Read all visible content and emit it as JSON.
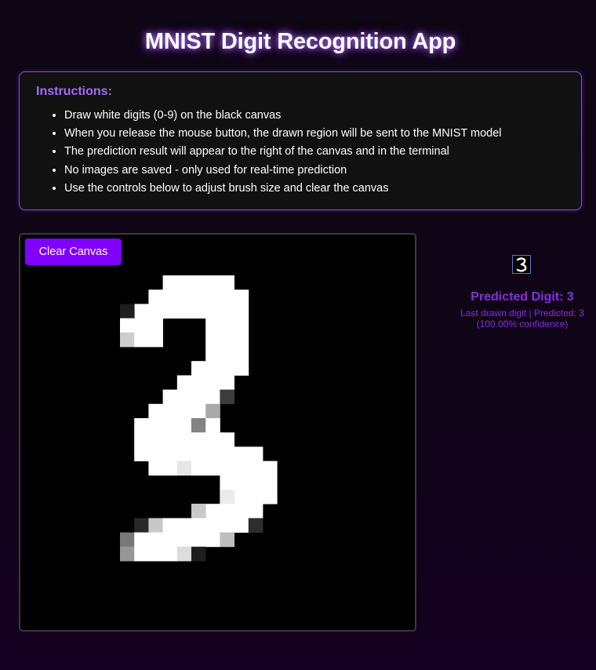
{
  "header": {
    "title": "MNIST Digit Recognition App"
  },
  "instructions": {
    "heading": "Instructions:",
    "items": [
      "Draw white digits (0-9) on the black canvas",
      "When you release the mouse button, the drawn region will be sent to the MNIST model",
      "The prediction result will appear to the right of the canvas and in the terminal",
      "No images are saved - only used for real-time prediction",
      "Use the controls below to adjust brush size and clear the canvas"
    ]
  },
  "canvas": {
    "clear_label": "Clear Canvas",
    "drawn_digit": "3"
  },
  "result": {
    "predicted_label": "Predicted Digit: 3",
    "detail_line_1": "Last drawn digit | Predicted: 3",
    "detail_line_2": "(100.00% confidence)",
    "accent_color": "#8a2be2"
  },
  "colors": {
    "background": "#100418",
    "accent": "#8000ff",
    "panel_border": "#8a4fe0"
  }
}
